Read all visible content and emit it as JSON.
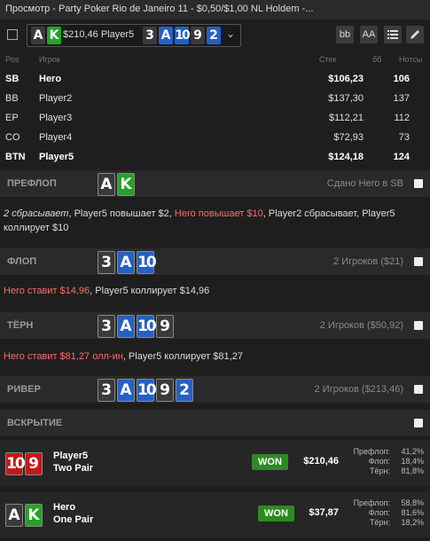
{
  "title": "Просмотр - Party Poker Rio de Janeiro 11 - $0,50/$1,00 NL Holdem -...",
  "toolbar": {
    "hand_amount": "$210,46 Player5",
    "btn_bb": "bb",
    "btn_aa": "AA",
    "hole_cards": [
      {
        "rank": "A",
        "suit": "s"
      },
      {
        "rank": "K",
        "suit": "c"
      }
    ],
    "board": [
      {
        "rank": "3",
        "suit": "s"
      },
      {
        "rank": "A",
        "suit": "d"
      },
      {
        "rank": "10",
        "suit": "d"
      },
      {
        "rank": "9",
        "suit": "s"
      },
      {
        "rank": "2",
        "suit": "d"
      }
    ]
  },
  "table": {
    "headers": {
      "pos": "Pos",
      "player": "Игрок",
      "stack": "Стек",
      "bb": "бб",
      "notes": "Нотсы"
    },
    "rows": [
      {
        "pos": "SB",
        "player": "Hero",
        "stack": "$106,23",
        "bb": "106",
        "bold": true
      },
      {
        "pos": "BB",
        "player": "Player2",
        "stack": "$137,30",
        "bb": "137",
        "bold": false
      },
      {
        "pos": "EP",
        "player": "Player3",
        "stack": "$112,21",
        "bb": "112",
        "bold": false
      },
      {
        "pos": "CO",
        "player": "Player4",
        "stack": "$72,93",
        "bb": "73",
        "bold": false
      },
      {
        "pos": "BTN",
        "player": "Player5",
        "stack": "$124,18",
        "bb": "124",
        "bold": true
      }
    ]
  },
  "streets": {
    "preflop": {
      "title": "ПРЕФЛОП",
      "info": "Сдано Hero в SB"
    },
    "flop": {
      "title": "ФЛОП",
      "info": "2 Игроков ($21)"
    },
    "turn": {
      "title": "ТЁРН",
      "info": "2 Игроков ($50,92)"
    },
    "river": {
      "title": "РИВЕР",
      "info": "2 Игроков ($213,46)"
    },
    "showdown": {
      "title": "ВСКРЫТИЕ"
    }
  },
  "actions": {
    "preflop": [
      {
        "t": "2 сбрасывает",
        "c": "it"
      },
      {
        "t": ", Player5 повышает $2, ",
        "c": ""
      },
      {
        "t": "Hero повышает $10",
        "c": "hero"
      },
      {
        "t": ", Player2 сбрасывает, Player5 коллирует $10",
        "c": ""
      }
    ],
    "flop": [
      {
        "t": "Hero ставит $14,96",
        "c": "hero"
      },
      {
        "t": ", Player5 коллирует $14,96",
        "c": ""
      }
    ],
    "turn": [
      {
        "t": "Hero ставит $81,27 олл-ин",
        "c": "hero"
      },
      {
        "t": ", Player5 коллирует $81,27",
        "c": ""
      }
    ]
  },
  "results": [
    {
      "name": "Player5",
      "hand": "Two Pair",
      "badge": "WON",
      "amount": "$210,46",
      "cards": [
        {
          "rank": "10",
          "suit": "h"
        },
        {
          "rank": "9",
          "suit": "h"
        }
      ],
      "stats": [
        {
          "label": "Префлоп:",
          "val": "41,2%"
        },
        {
          "label": "Флоп:",
          "val": "18,4%"
        },
        {
          "label": "Тёрн:",
          "val": "81,8%"
        }
      ]
    },
    {
      "name": "Hero",
      "hand": "One Pair",
      "badge": "WON",
      "amount": "$37,87",
      "cards": [
        {
          "rank": "A",
          "suit": "s"
        },
        {
          "rank": "K",
          "suit": "c"
        }
      ],
      "stats": [
        {
          "label": "Префлоп:",
          "val": "58,8%"
        },
        {
          "label": "Флоп:",
          "val": "81,6%"
        },
        {
          "label": "Тёрн:",
          "val": "18,2%"
        }
      ]
    }
  ]
}
